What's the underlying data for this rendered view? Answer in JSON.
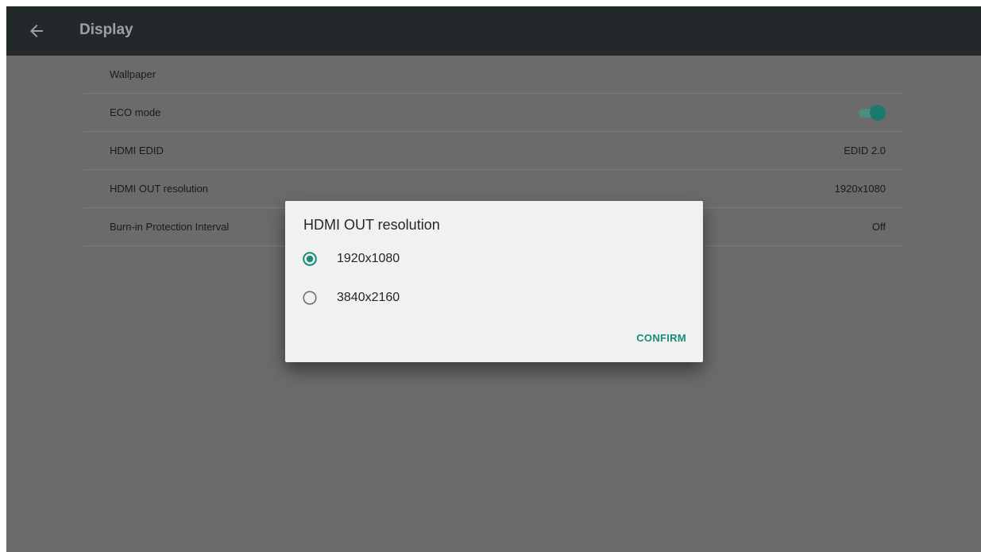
{
  "appbar": {
    "title": "Display",
    "back_icon": "arrow-left-icon"
  },
  "settings": {
    "items": [
      {
        "label": "Wallpaper",
        "value": ""
      },
      {
        "label": "ECO mode",
        "value": "",
        "toggle_on": true
      },
      {
        "label": "HDMI EDID",
        "value": "EDID 2.0"
      },
      {
        "label": "HDMI OUT resolution",
        "value": "1920x1080"
      },
      {
        "label": "Burn-in Protection Interval",
        "value": "Off"
      }
    ]
  },
  "dialog": {
    "title": "HDMI OUT resolution",
    "options": [
      {
        "label": "1920x1080",
        "selected": true
      },
      {
        "label": "3840x2160",
        "selected": false
      }
    ],
    "confirm_label": "CONFIRM"
  },
  "colors": {
    "appbar_bg": "#23282b",
    "accent": "#1a8b78",
    "backdrop": "#6b6b6b",
    "dialog_bg": "#f0f1f1"
  }
}
